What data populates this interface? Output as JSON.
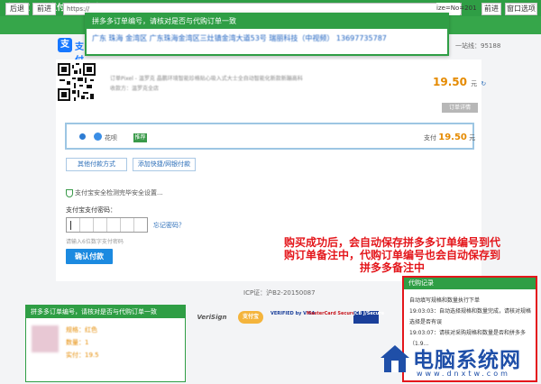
{
  "window": {
    "title": "支付宝 网上支付 安全快速！",
    "controls": [
      "▾",
      "─",
      "□",
      "✕"
    ]
  },
  "toolbar": {
    "back_label": "后退",
    "forward_label": "前进",
    "url": "https://",
    "url_tail": "ize=No=201",
    "right_buttons": [
      "前进",
      "窗口选项"
    ]
  },
  "popup": {
    "title": "拼多多订单编号，请核对是否与代购订单一致",
    "body": "广东 珠海 金湾区 广东珠海金湾区三灶镇金湾大道53号 瑞丽科技（中视频） 13697735787"
  },
  "brand": {
    "logo_char": "支",
    "logo_text": "支付宝",
    "service": "一站线：95188"
  },
  "order": {
    "info_lines": [
      "订单Pixel - 温罗克 晶鹏环境智能珍格贴心吸入式大士全自动智能化新款新蹦高科",
      "收款方：温罗克全店"
    ],
    "amount": "19.50",
    "amount_unit": "元",
    "details_label": "订单详情"
  },
  "payment": {
    "method_label": "花呗",
    "method_badge": "推荐",
    "pay_prefix": "支付",
    "pay_amount": "19.50",
    "pay_unit": "元",
    "other_methods_label": "其他付款方式",
    "add_card_label": "添加快捷/网银付款"
  },
  "security": {
    "note": "支付宝安全检测完毕安全设置...",
    "pw_label": "支付宝支付密码：",
    "forgot_label": "忘记密码？",
    "pw_hint": "请输入6位数字支付密码",
    "confirm_label": "确认付款"
  },
  "annotation": {
    "text": "购买成功后，会自动保存拼多多订单编号到代购订单备注中，代购订单编号也会自动保存到拼多多备注中"
  },
  "footer": {
    "icp": "ICP证：沪B2-20150087"
  },
  "pdd_panel": {
    "title": "拼多多订单编号，请核对是否与代购订单一致",
    "lines": [
      "规格：红色",
      "数量：1",
      "实付：19.5"
    ]
  },
  "trust_logos": [
    "VeriSign",
    "支付宝",
    "VERIFIED by VISA",
    "MasterCard SecureCode",
    "JCB J/Secure"
  ],
  "log_panel": {
    "title": "代购记录",
    "lines": [
      "自动填写规格和数量执行下单",
      "19:03:03：自动选择规格和数量完成，请核对规格",
      "选择是否有误",
      "19:03:07：请核对采购规格和数量是否和拼多多",
      "（1.9..."
    ]
  },
  "watermark": {
    "title": "电脑系统网",
    "url": "www.dnxtw.com"
  },
  "colors": {
    "green": "#2f9e45",
    "blue": "#1c8ae0",
    "orange": "#e58a00",
    "red": "#e4161b"
  }
}
